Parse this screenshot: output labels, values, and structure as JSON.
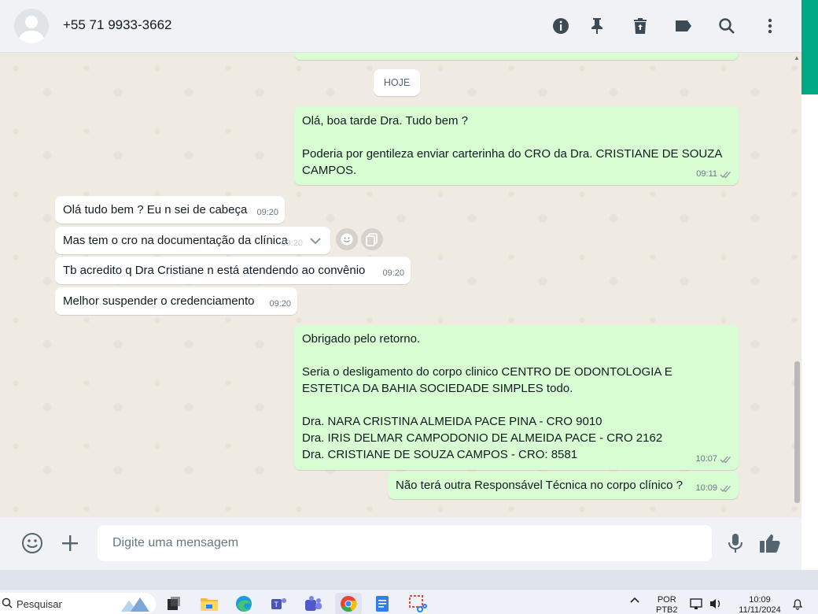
{
  "header": {
    "contact": "+55 71 9933-3662",
    "icons": [
      "info-icon",
      "pin-icon",
      "delete-icon",
      "label-icon",
      "search-icon",
      "menu-icon"
    ]
  },
  "chat": {
    "day_label": "HOJE",
    "messages": [
      {
        "dir": "out",
        "text": "Olá, boa tarde Dra. Tudo bem ?\n\nPoderia por gentileza enviar carterinha do CRO da Dra. CRISTIANE DE SOUZA CAMPOS.",
        "time": "09:11",
        "ticks": true
      },
      {
        "dir": "in",
        "text": "Olá tudo bem ? Eu n sei de cabeça",
        "time": "09:20"
      },
      {
        "dir": "in",
        "text": "Mas tem o cro na documentação da clínica",
        "time": "09:20"
      },
      {
        "dir": "in",
        "text": "Tb acredito q Dra Cristiane n está atendendo ao convênio",
        "time": "09:20"
      },
      {
        "dir": "in",
        "text": "Melhor suspender o credenciamento",
        "time": "09:20"
      },
      {
        "dir": "out",
        "text": "Obrigado pelo retorno.\n\nSeria o desligamento do corpo clinico CENTRO DE ODONTOLOGIA E ESTETICA DA BAHIA SOCIEDADE SIMPLES todo.\n\nDra. NARA CRISTINA ALMEIDA PACE PINA - CRO 9010\nDra. IRIS DELMAR CAMPODONIO DE ALMEIDA PACE - CRO 2162\nDra. CRISTIANE DE SOUZA CAMPOS - CRO: 8581",
        "time": "10:07",
        "ticks": true
      },
      {
        "dir": "out",
        "text": "Não terá outra Responsável Técnica no corpo clínico ?",
        "time": "10:09",
        "ticks": true
      }
    ]
  },
  "footer": {
    "placeholder": "Digite uma mensagem"
  },
  "taskbar": {
    "search": "Pesquisar",
    "lang_top": "POR",
    "lang_bottom": "PTB2",
    "time": "10:09",
    "date": "11/11/2024"
  },
  "colors": {
    "outgoing": "#d9fdd3",
    "incoming": "#ffffff",
    "accent": "#00a884",
    "ticks": "#8696a0"
  }
}
